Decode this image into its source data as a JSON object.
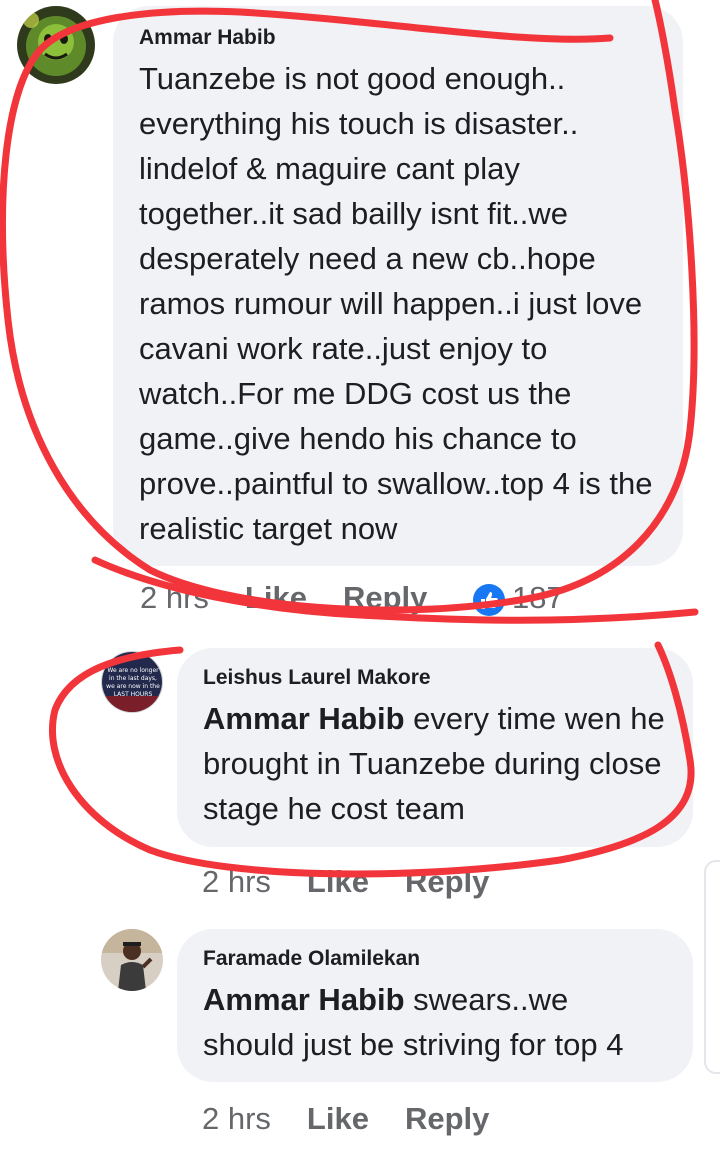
{
  "comments": [
    {
      "author": "Ammar Habib",
      "mention": "",
      "text": "Tuanzebe is not good enough.. everything his touch is disaster.. lindelof & maguire cant play together..it sad bailly isnt fit..we desperately need a new cb..hope ramos rumour will happen..i just love cavani work rate..just enjoy to watch..For me DDG cost us the game..give hendo his chance to prove..paintful to swallow..top 4 is the realistic target now",
      "time": "2 hrs",
      "like": "Like",
      "reply": "Reply",
      "reaction_count": "187",
      "reaction_icon": "like-reaction-icon",
      "avatar_icon": "green-creature-avatar"
    },
    {
      "author": "Leishus Laurel Makore",
      "mention": "Ammar Habib",
      "text": " every time wen he brought in Tuanzebe during close stage he cost team",
      "time": "2 hrs",
      "like": "Like",
      "reply": "Reply",
      "avatar_text": "\"We are no longer in the last days, we are now in the LAST HOURS\"",
      "avatar_icon": "quote-image-avatar"
    },
    {
      "author": "Faramade Olamilekan",
      "mention": "Ammar Habib",
      "text": " swears..we should just be striving for top 4",
      "time": "2 hrs",
      "like": "Like",
      "reply": "Reply",
      "avatar_icon": "person-photo-avatar"
    }
  ],
  "colors": {
    "bubble": "#f0f2f5",
    "meta": "#65676b",
    "text": "#1c1e21",
    "like_blue": "#1877f2",
    "scribble": "#f2353b"
  }
}
